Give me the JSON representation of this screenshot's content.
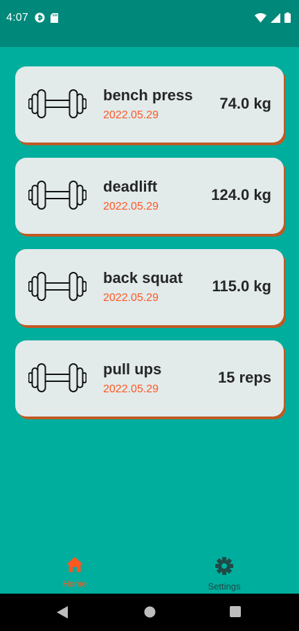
{
  "status_bar": {
    "time": "4:07",
    "icons": [
      "app-notification-icon",
      "sd-card-icon",
      "wifi-icon",
      "cell-signal-icon",
      "battery-icon"
    ]
  },
  "exercises": [
    {
      "name": "bench press",
      "date": "2022.05.29",
      "value": "74.0 kg",
      "icon": "dumbbell-icon"
    },
    {
      "name": "deadlift",
      "date": "2022.05.29",
      "value": "124.0 kg",
      "icon": "dumbbell-icon"
    },
    {
      "name": "back squat",
      "date": "2022.05.29",
      "value": "115.0 kg",
      "icon": "dumbbell-icon"
    },
    {
      "name": "pull ups",
      "date": "2022.05.29",
      "value": "15 reps",
      "icon": "dumbbell-icon"
    }
  ],
  "bottom_nav": {
    "items": [
      {
        "label": "Home",
        "icon": "home-icon",
        "active": true
      },
      {
        "label": "Settings",
        "icon": "gear-icon",
        "active": false
      }
    ]
  },
  "system_nav": [
    "back-icon",
    "home-circle-icon",
    "recents-icon"
  ],
  "colors": {
    "status_bar": "#00897b",
    "background": "#00ae9d",
    "card": "#e2eaea",
    "card_shadow": "#c05a24",
    "accent": "#ff5722",
    "text": "#262626"
  }
}
